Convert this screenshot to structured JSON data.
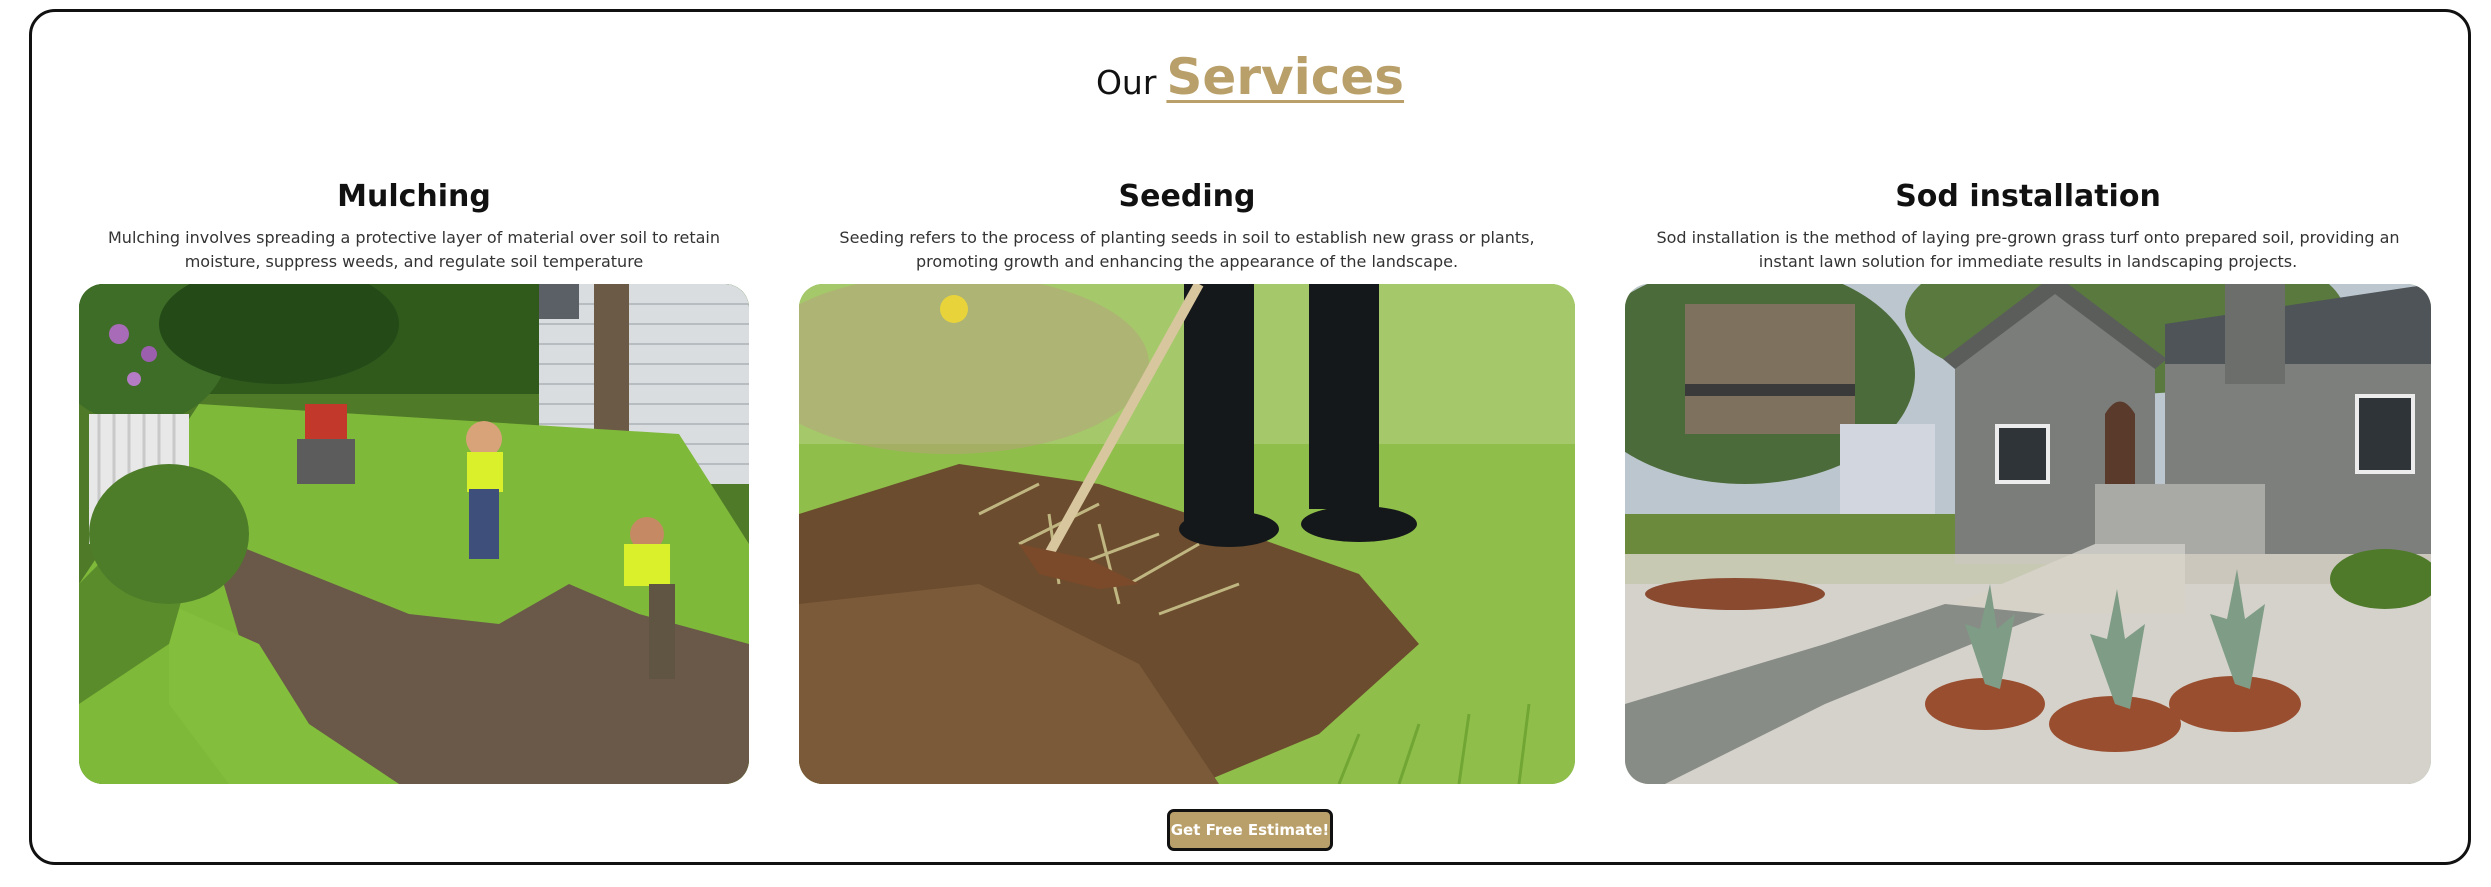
{
  "heading": {
    "prefix": "Our",
    "accent": "Services"
  },
  "services": [
    {
      "title": "Mulching",
      "description": "Mulching involves spreading a protective layer of material over soil to retain moisture, suppress weeds, and regulate soil temperature"
    },
    {
      "title": "Seeding",
      "description": "Seeding refers to the process of planting seeds in soil to establish new grass or plants, promoting growth and enhancing the appearance of the landscape."
    },
    {
      "title": "Sod installation",
      "description": "Sod installation is the method of laying pre-grown grass turf onto prepared soil, providing an instant lawn solution for immediate results in landscaping projects."
    }
  ],
  "cta": {
    "label": "Get Free Estimate!"
  },
  "colors": {
    "accent": "#b9a06a",
    "border": "#111111",
    "background": "#ffffff"
  }
}
